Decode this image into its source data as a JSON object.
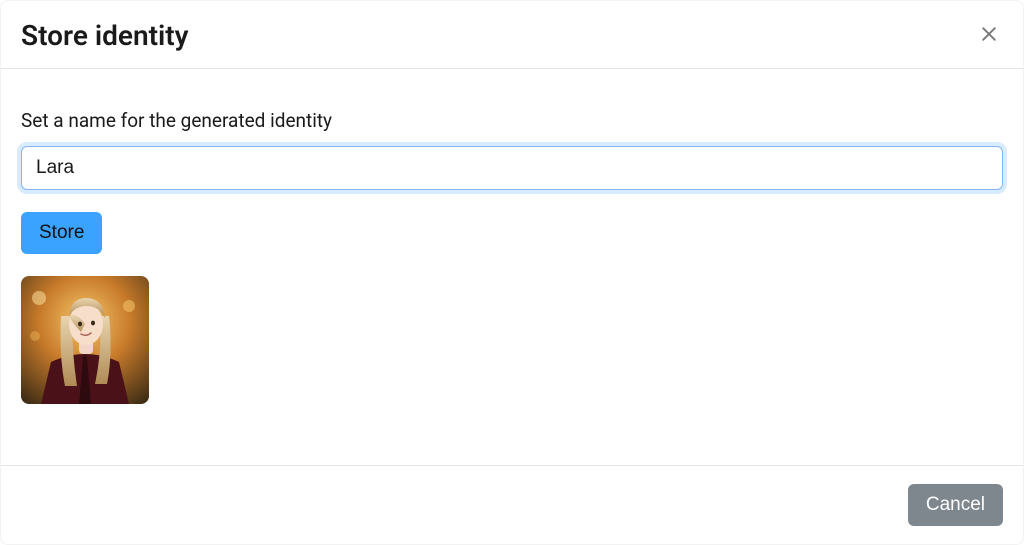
{
  "modal": {
    "title": "Store identity",
    "close_icon": "close-icon"
  },
  "form": {
    "label": "Set a name for the generated identity",
    "name_value": "Lara",
    "name_placeholder": "",
    "store_label": "Store"
  },
  "preview": {
    "alt": "generated-identity-preview"
  },
  "footer": {
    "cancel_label": "Cancel"
  }
}
